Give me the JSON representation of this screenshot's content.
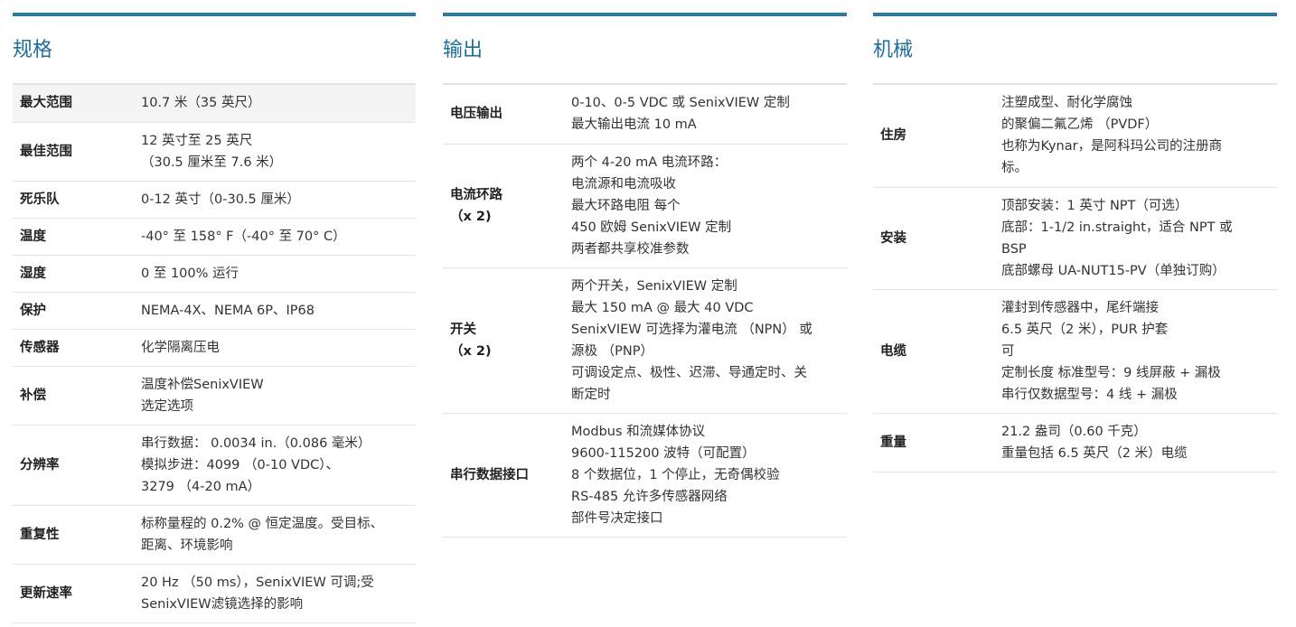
{
  "columns": [
    {
      "title": "规格",
      "rows": [
        {
          "key": "最大范围",
          "value": "10.7 米（35 英尺）"
        },
        {
          "key": "最佳范围",
          "value": "12 英寸至 25 英尺\n（30.5 厘米至 7.6 米）"
        },
        {
          "key": "死乐队",
          "value": "0-12 英寸（0-30.5 厘米）"
        },
        {
          "key": "温度",
          "value": "-40° 至 158° F（-40° 至 70° C）"
        },
        {
          "key": "湿度",
          "value": "0 至 100% 运行"
        },
        {
          "key": "保护",
          "value": "NEMA-4X、NEMA 6P、IP68"
        },
        {
          "key": "传感器",
          "value": "化学隔离压电"
        },
        {
          "key": "补偿",
          "value": "温度补偿SenixVIEW\n选定选项"
        },
        {
          "key": "分辨率",
          "value": "串行数据： 0.0034 in.（0.086 毫米）\n模拟步进：4099 （0-10 VDC）、\n3279 （4-20 mA）"
        },
        {
          "key": "重复性",
          "value": "标称量程的 0.2% @ 恒定温度。受目标、\n距离、环境影响"
        },
        {
          "key": "更新速率",
          "value": "20 Hz （50 ms），SenixVIEW 可调;受\nSenixVIEW滤镜选择的影响"
        }
      ]
    },
    {
      "title": "输出",
      "rows": [
        {
          "key": "电压输出",
          "value": "0-10、0-5 VDC 或 SenixVIEW 定制\n最大输出电流 10 mA"
        },
        {
          "key": "电流环路\n（x 2)",
          "value": "两个 4-20 mA 电流环路：\n电流源和电流吸收\n最大环路电阻 每个\n450 欧姆 SenixVIEW 定制\n两者都共享校准参数"
        },
        {
          "key": "开关\n（x 2)",
          "value": "两个开关，SenixVIEW 定制\n最大 150 mA @ 最大 40 VDC\nSenixVIEW 可选择为灌电流 （NPN） 或\n源极 （PNP）\n可调设定点、极性、迟滞、导通定时、关\n断定时"
        },
        {
          "key": "串行数据接口",
          "value": "Modbus 和流媒体协议\n9600-115200 波特（可配置）\n8 个数据位，1 个停止，无奇偶校验\nRS-485 允许多传感器网络\n部件号决定接口"
        }
      ]
    },
    {
      "title": "机械",
      "rows": [
        {
          "key": "住房",
          "value": "注塑成型、耐化学腐蚀\n的聚偏二氟乙烯 （PVDF）\n也称为Kynar，是阿科玛公司的注册商\n标。"
        },
        {
          "key": "安装",
          "value": "顶部安装：1 英寸 NPT（可选）\n底部：1-1/2 in.straight，适合 NPT 或\nBSP\n底部螺母 UA-NUT15-PV（单独订购）"
        },
        {
          "key": "电缆",
          "value": "灌封到传感器中，尾纤端接\n6.5 英尺（2 米），PUR 护套\n可\n定制长度 标准型号：9 线屏蔽 + 漏极\n串行仅数据型号：4 线 + 漏极"
        },
        {
          "key": "重量",
          "value": "21.2 盎司（0.60 千克）\n重量包括 6.5 英尺（2 米）电缆"
        }
      ]
    }
  ]
}
